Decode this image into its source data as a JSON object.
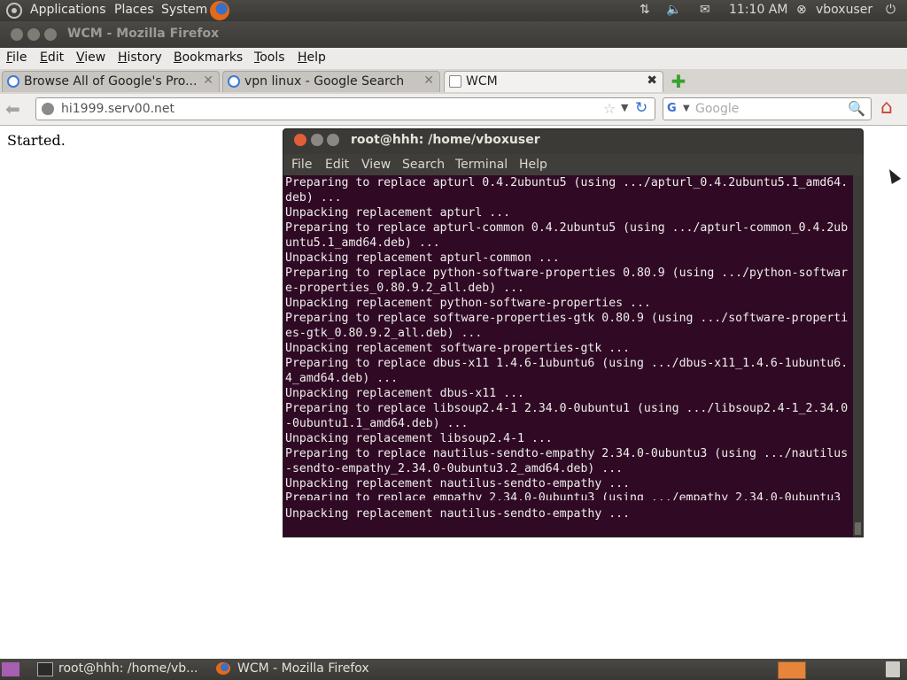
{
  "top_panel": {
    "menus": [
      "Applications",
      "Places",
      "System"
    ],
    "clock": "11:10 AM",
    "user": "vboxuser"
  },
  "firefox": {
    "window_title": "WCM - Mozilla Firefox",
    "menubar": [
      "File",
      "Edit",
      "View",
      "History",
      "Bookmarks",
      "Tools",
      "Help"
    ],
    "tabs": [
      {
        "label": "Browse All of Google's Pro...",
        "active": false
      },
      {
        "label": "vpn linux - Google Search",
        "active": false
      },
      {
        "label": "WCM",
        "active": true
      }
    ],
    "url": "hi1999.serv00.net",
    "search_placeholder": "Google",
    "page_text": "Started."
  },
  "terminal": {
    "title": "root@hhh: /home/vboxuser",
    "menus": [
      "File",
      "Edit",
      "View",
      "Search",
      "Terminal",
      "Help"
    ],
    "lines": [
      "Preparing to replace apturl 0.4.2ubuntu5 (using .../apturl_0.4.2ubuntu5.1_amd64.",
      "deb) ...",
      "Unpacking replacement apturl ...",
      "Preparing to replace apturl-common 0.4.2ubuntu5 (using .../apturl-common_0.4.2ub",
      "untu5.1_amd64.deb) ...",
      "Unpacking replacement apturl-common ...",
      "Preparing to replace python-software-properties 0.80.9 (using .../python-softwar",
      "e-properties_0.80.9.2_all.deb) ...",
      "Unpacking replacement python-software-properties ...",
      "Preparing to replace software-properties-gtk 0.80.9 (using .../software-properti",
      "es-gtk_0.80.9.2_all.deb) ...",
      "Unpacking replacement software-properties-gtk ...",
      "Preparing to replace dbus-x11 1.4.6-1ubuntu6 (using .../dbus-x11_1.4.6-1ubuntu6.",
      "4_amd64.deb) ...",
      "Unpacking replacement dbus-x11 ...",
      "Preparing to replace libsoup2.4-1 2.34.0-0ubuntu1 (using .../libsoup2.4-1_2.34.0",
      "-0ubuntu1.1_amd64.deb) ...",
      "Unpacking replacement libsoup2.4-1 ...",
      "Preparing to replace nautilus-sendto-empathy 2.34.0-0ubuntu3 (using .../nautilus",
      "-sendto-empathy_2.34.0-0ubuntu3.2_amd64.deb) ...",
      "Unpacking replacement nautilus-sendto-empathy ...",
      "Preparing to replace empathy 2.34.0-0ubuntu3 (using .../empathy_2.34.0-0ubuntu3",
      "Unpacking replacement nautilus-sendto-empathy ..."
    ]
  },
  "taskbar": {
    "items": [
      "root@hhh: /home/vb...",
      "WCM - Mozilla Firefox"
    ]
  }
}
